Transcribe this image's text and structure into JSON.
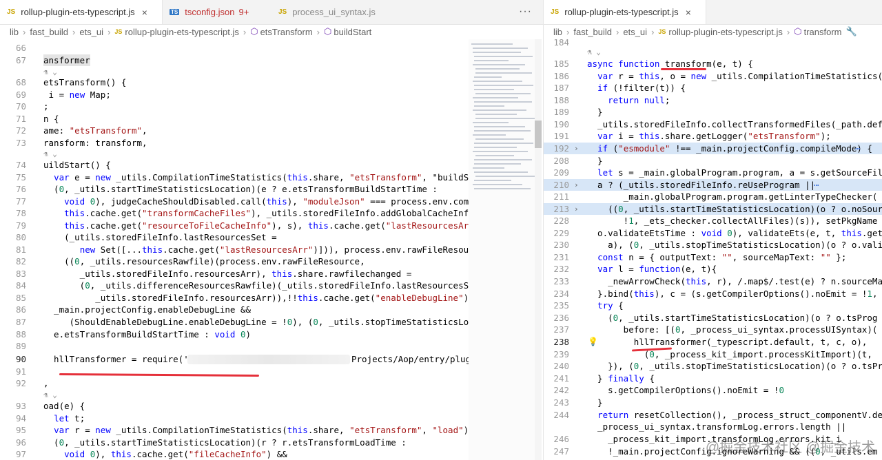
{
  "left": {
    "tabs": [
      {
        "icon": "JS",
        "label": "rollup-plugin-ets-typescript.js",
        "active": true,
        "close": "×"
      },
      {
        "icon": "TS",
        "label": "tsconfig.json",
        "badge": "9+",
        "modified": true
      },
      {
        "icon": "JS",
        "label": "process_ui_syntax.js",
        "dim": true
      }
    ],
    "more": "···",
    "breadcrumb": [
      "lib",
      "fast_build",
      "ets_ui",
      "rollup-plugin-ets-typescript.js",
      "etsTransform",
      "buildStart"
    ],
    "code_lines": [
      {
        "num": "66",
        "text": ""
      },
      {
        "num": "67",
        "text": "ansformer"
      },
      {
        "num": "68",
        "text": "etsTransform() {"
      },
      {
        "num": "69",
        "text": " i = new Map;"
      },
      {
        "num": "70",
        "text": ";"
      },
      {
        "num": "71",
        "text": "n {"
      },
      {
        "num": "72",
        "text": "ame: \"etsTransform\","
      },
      {
        "num": "73",
        "text": "ransform: transform,"
      },
      {
        "num": "74",
        "text": "uildStart() {"
      },
      {
        "num": "75",
        "text": "  var e = new _utils.CompilationTimeStatistics(this.share, \"etsTransform\", \"buildStart"
      },
      {
        "num": "76",
        "text": "  (0, _utils.startTimeStatisticsLocation)(e ? e.etsTransformBuildStartTime :"
      },
      {
        "num": "77",
        "text": "    void 0), judgeCacheShouldDisabled.call(this), \"moduleJson\" === process.env.compi"
      },
      {
        "num": "78",
        "text": "    this.cache.get(\"transformCacheFiles\"), _utils.storedFileInfo.addGlobalCacheInfo("
      },
      {
        "num": "79",
        "text": "    this.cache.get(\"resourceToFileCacheInfo\"), s), this.cache.get(\"lastResourcesArr\""
      },
      {
        "num": "80",
        "text": "    (_utils.storedFileInfo.lastResourcesSet ="
      },
      {
        "num": "81",
        "text": "       new Set([...this.cache.get(\"lastResourcesArr\")])), process.env.rawFileResour"
      },
      {
        "num": "82",
        "text": "    ((0, _utils.resourcesRawfile)(process.env.rawFileResource,"
      },
      {
        "num": "83",
        "text": "       _utils.storedFileInfo.resourcesArr), this.share.rawfilechanged ="
      },
      {
        "num": "84",
        "text": "       (0, _utils.differenceResourcesRawfile)(_utils.storedFileInfo.lastResourcesSe"
      },
      {
        "num": "85",
        "text": "          _utils.storedFileInfo.resourcesArr)),!!this.cache.get(\"enableDebugLine\")"
      },
      {
        "num": "86",
        "text": "  _main.projectConfig.enableDebugLine &&"
      },
      {
        "num": "87",
        "text": "     (ShouldEnableDebugLine.enableDebugLine = !0), (0, _utils.stopTimeStatisticsLocat"
      },
      {
        "num": "88",
        "text": "  e.etsTransformBuildStartTime : void 0)"
      },
      {
        "num": "89",
        "text": ""
      },
      {
        "num": "90",
        "text": "  hllTransformer = require('"
      },
      {
        "num": "91",
        "text": ""
      },
      {
        "num": "92",
        "text": ""
      },
      {
        "num": "93",
        "text": "oad(e) {"
      },
      {
        "num": "94",
        "text": "  let t;"
      },
      {
        "num": "95",
        "text": "  var r = new _utils.CompilationTimeStatistics(this.share, \"etsTransform\", \"load\");"
      },
      {
        "num": "96",
        "text": "  (0, _utils.startTimeStatisticsLocation)(r ? r.etsTransformLoadTime :"
      },
      {
        "num": "97",
        "text": "    void 0), this.cache.get(\"fileCacheInfo\") &&"
      }
    ],
    "line90_tail": "Projects/Aop/entry/plugi",
    "line92_text": ",",
    "lens_glyph": "⚗ ⌄"
  },
  "right": {
    "tabs": [
      {
        "icon": "JS",
        "label": "rollup-plugin-ets-typescript.js",
        "active": true,
        "close": "×"
      }
    ],
    "breadcrumb": [
      "lib",
      "fast_build",
      "ets_ui",
      "rollup-plugin-ets-typescript.js",
      "transform"
    ],
    "code_lines": [
      {
        "num": "184",
        "text": ""
      },
      {
        "num": "185",
        "text": "async function transform(e, t) {"
      },
      {
        "num": "186",
        "text": "  var r = this, o = new _utils.CompilationTimeStatistics(th"
      },
      {
        "num": "187",
        "text": "  if (!filter(t)) {"
      },
      {
        "num": "188",
        "text": "    return null;"
      },
      {
        "num": "189",
        "text": "  }"
      },
      {
        "num": "190",
        "text": "  _utils.storedFileInfo.collectTransformedFiles(_path.defau"
      },
      {
        "num": "191",
        "text": "  var i = this.share.getLogger(\"etsTransform\");"
      },
      {
        "num": "192",
        "text": "  if (\"esmodule\" !== _main.projectConfig.compileMode) {"
      },
      {
        "num": "208",
        "text": "  }"
      },
      {
        "num": "209",
        "text": "  let s = _main.globalProgram.program, a = s.getSourceFile("
      },
      {
        "num": "210",
        "text": "  a ? (_utils.storedFileInfo.reUseProgram ||"
      },
      {
        "num": "211",
        "text": "       _main.globalProgram.program.getLinterTypeChecker("
      },
      {
        "num": "213",
        "text": "    ((0, _utils.startTimeStatisticsLocation)(o ? o.noSour"
      },
      {
        "num": "228",
        "text": "       !1, _ets_checker.collectAllFiles)(s)), setPkgName"
      },
      {
        "num": "229",
        "text": "  o.validateEtsTime : void 0), validateEts(e, t, this.getMo"
      },
      {
        "num": "230",
        "text": "    a), (0, _utils.stopTimeStatisticsLocation)(o ? o.vali"
      },
      {
        "num": "231",
        "text": "  const n = { outputText: \"\", sourceMapText: \"\" };"
      },
      {
        "num": "232",
        "text": "  var l = function(e, t){"
      },
      {
        "num": "233",
        "text": "    _newArrowCheck(this, r), /.map$/.test(e) ? n.sourceMa"
      },
      {
        "num": "234",
        "text": "  }.bind(this), c = (s.getCompilerOptions().noEmit = !1, th"
      },
      {
        "num": "235",
        "text": "  try {"
      },
      {
        "num": "236",
        "text": "    (0, _utils.startTimeStatisticsLocation)(o ? o.tsProg"
      },
      {
        "num": "237",
        "text": "       before: [(0, _process_ui_syntax.processUISyntax)("
      },
      {
        "num": "238",
        "text": "         hllTransformer(_typescript.default, t, c, o),"
      },
      {
        "num": "239",
        "text": "           (0, _process_kit_import.processKitImport)(t,"
      },
      {
        "num": "240",
        "text": "    }), (0, _utils.stopTimeStatisticsLocation)(o ? o.tsPr"
      },
      {
        "num": "241",
        "text": "  } finally {"
      },
      {
        "num": "242",
        "text": "    s.getCompilerOptions().noEmit = !0"
      },
      {
        "num": "243",
        "text": "  }"
      },
      {
        "num": "244",
        "text": "  return resetCollection(), _process_struct_componentV.defa"
      },
      {
        "num": "245",
        "text": "  _process_ui_syntax.transformLog.errors.length ||"
      },
      {
        "num": "246",
        "text": "    _process_kit_import.transformLog.errors.kit_i"
      },
      {
        "num": "247",
        "text": "    !_main.projectConfig.ignoreWarning && ((0, _utils.em"
      }
    ],
    "watermark": "@掘金技术社区 @掘金技术"
  },
  "colors": {
    "keyword": "#0000ff",
    "string": "#a31515",
    "underline": "#e5303a",
    "js_icon": "#c9a400",
    "ts_icon": "#3178c6"
  }
}
